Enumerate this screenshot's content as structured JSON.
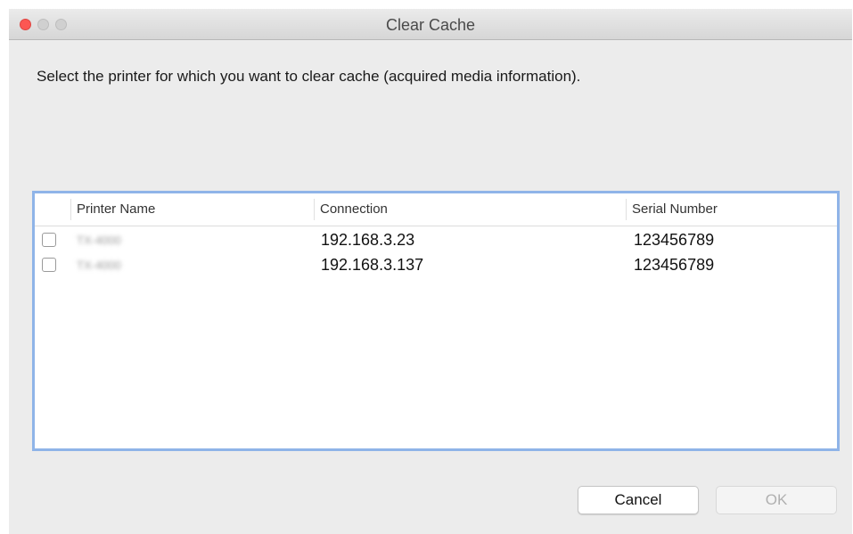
{
  "window": {
    "title": "Clear Cache"
  },
  "instruction": "Select the printer for which you want to clear cache (acquired media information).",
  "table": {
    "columns": [
      "Printer Name",
      "Connection",
      "Serial Number"
    ],
    "rows": [
      {
        "checked": false,
        "printer_name": "TX-4000",
        "connection": "192.168.3.23",
        "serial_number": "123456789"
      },
      {
        "checked": false,
        "printer_name": "TX-4000",
        "connection": "192.168.3.137",
        "serial_number": "123456789"
      }
    ]
  },
  "buttons": {
    "cancel_label": "Cancel",
    "ok_label": "OK"
  },
  "colors": {
    "close_button": "#fc5753",
    "focus_ring": "#8fb4e8"
  }
}
